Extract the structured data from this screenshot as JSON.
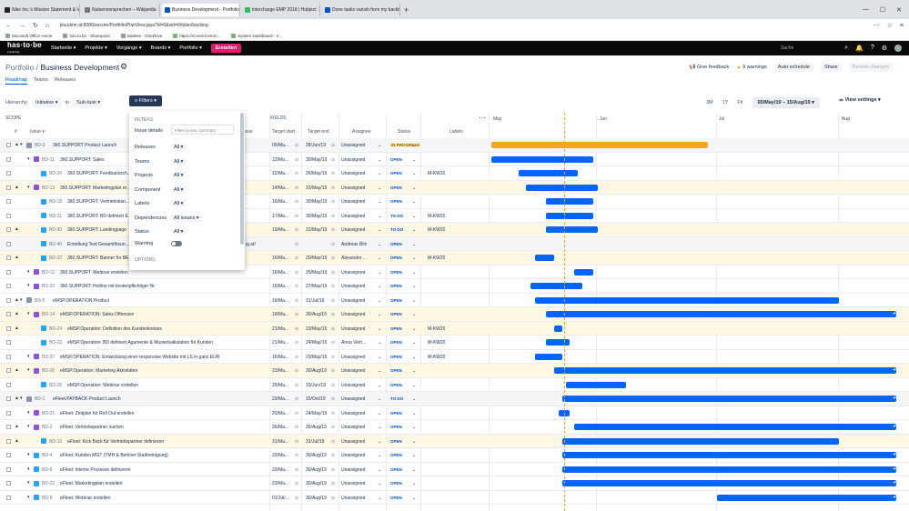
{
  "browser": {
    "tabs": [
      {
        "title": "Nike Inc.'s Mission Statement & Vision",
        "active": false,
        "fav": "#222"
      },
      {
        "title": "Nutzenversprechen – Wikipedia",
        "active": false,
        "fav": "#777"
      },
      {
        "title": "Business Development - Portfolio",
        "active": true,
        "fav": "#0052cc"
      },
      {
        "title": "intercharge EMP 2018 | Hubject",
        "active": false,
        "fav": "#3b6"
      },
      {
        "title": "Done tasks vanish from my backlog",
        "active": false,
        "fav": "#0052cc"
      }
    ],
    "new_tab": "+",
    "url": "jira.kkmr.at:8080/secure/PortfolioPlanView.jspa?id=6&sid=6#plan/backlog",
    "bookmarks": [
      "Microsoft Office Home",
      "has.to.be - Sharepoint",
      "Dateien - OneDrive",
      "https://ncontrol.eKon...",
      "System Dashboard - X..."
    ]
  },
  "jira_nav": {
    "logo": "has·to·be",
    "logo_sub": "emobility",
    "items": [
      "Startseite ▾",
      "Projekte ▾",
      "Vorgänge ▾",
      "Boards ▾",
      "Portfolio ▾"
    ],
    "create": "Erstellen",
    "search_placeholder": "Suche"
  },
  "header": {
    "breadcrumb_root": "Portfolio",
    "breadcrumb_sep": "/",
    "title": "Business Development",
    "tabs": [
      "Roadmap",
      "Teams",
      "Releases"
    ],
    "give_feedback": "Give feedback",
    "warnings": "9 warnings",
    "auto_schedule": "Auto-schedule",
    "share": "Share",
    "review_changes": "Review changes"
  },
  "controls": {
    "hierarchy_label": "Hierarchy:",
    "hierarchy_from": "Initiative",
    "hierarchy_to_label": "to",
    "hierarchy_to": "Sub-task",
    "filters": "Filters",
    "zoom": [
      "3M",
      "1Y",
      "Fit"
    ],
    "range": "05/May/19 – 15/Aug/19",
    "view_settings": "View settings"
  },
  "columns": {
    "scope": "SCOPE",
    "issue": "Issue",
    "fields": "FIELDS",
    "target_start": "Target start",
    "target_end": "Target end",
    "assignee": "Assignee",
    "status": "Status",
    "labels": "Labels",
    "months": [
      "May",
      "Jun",
      "Jul",
      "Aug"
    ],
    "issue_partial": "e issue"
  },
  "filter_panel": {
    "title": "FILTERS",
    "include_label": "lnoue details",
    "search_placeholder": "Filter by key, summary",
    "rows": [
      {
        "label": "Releases",
        "value": "All"
      },
      {
        "label": "Teams",
        "value": "All"
      },
      {
        "label": "Projects",
        "value": "All"
      },
      {
        "label": "Component",
        "value": "All"
      },
      {
        "label": "Labels",
        "value": "All"
      },
      {
        "label": "Dependencies",
        "value": "All issues"
      },
      {
        "label": "Status",
        "value": "All"
      }
    ],
    "warning_label": "Warning",
    "options": "OPTIONS"
  },
  "rows": [
    {
      "key": "BD-3",
      "summary": "360.SUPPORT Product Launch",
      "type": "init",
      "indent": 0,
      "start": "05/Ma...",
      "end": "28/Jun/19",
      "assignee": "Unassigned",
      "status": "IN PROGRESS",
      "labels": "",
      "bar": [
        540,
        778
      ],
      "color": "orange",
      "style": "grey",
      "warn": true
    },
    {
      "key": "BD-11",
      "summary": "360.SUPPORT: Sales",
      "type": "epic",
      "indent": 1,
      "start": "12/Ma...",
      "end": "30/May/19",
      "assignee": "Unassigned",
      "status": "OPEN",
      "labels": "",
      "bar": [
        540,
        652
      ],
      "style": ""
    },
    {
      "key": "BD-20",
      "summary": "360.SUPPORT: Feedbacksch...",
      "type": "story",
      "indent": 2,
      "start": "12/Ma...",
      "end": "26/May/19",
      "assignee": "Unassigned",
      "status": "OPEN",
      "labels": "M-KW20",
      "bar": [
        570,
        635
      ],
      "style": ""
    },
    {
      "key": "BD-13",
      "summary": "360.SUPPORT: Marketingplan er...",
      "type": "epic",
      "indent": 1,
      "start": "14/Ma...",
      "end": "31/May/19",
      "assignee": "Unassigned",
      "status": "OPEN",
      "labels": "",
      "bar": [
        578,
        657
      ],
      "style": "alt",
      "warn": true
    },
    {
      "key": "BD-18",
      "summary": "360.SUPPORT: Vertriebskan...",
      "type": "story",
      "indent": 2,
      "start": "16/Ma...",
      "end": "30/May/19",
      "assignee": "Unassigned",
      "status": "OPEN",
      "labels": "",
      "bar": [
        600,
        652
      ],
      "style": ""
    },
    {
      "key": "BD-31",
      "summary": "360.SUPPORT: BD definiert E...",
      "type": "story",
      "indent": 2,
      "start": "17/Ma...",
      "end": "30/May/19",
      "assignee": "Unassigned",
      "status": "TO DO",
      "labels": "M-KW20",
      "bar": [
        600,
        652
      ],
      "style": ""
    },
    {
      "key": "BD-30",
      "summary": "360.SUPPORT: Landingpage",
      "type": "story",
      "indent": 2,
      "start": "19/Ma...",
      "end": "31/May/19",
      "assignee": "Unassigned",
      "status": "TO DO",
      "labels": "M-KW20",
      "bar": [
        600,
        657
      ],
      "style": "alt",
      "warn": true
    },
    {
      "key": "BD-40",
      "summary": "Erstellung Text Gesamtlösun...",
      "type": "story",
      "indent": 2,
      "start": "",
      "end": "",
      "assignee": "Andreas Blin",
      "status": "OPEN",
      "labels": "",
      "bar": null,
      "style": "grey",
      "extra": "ig.at/"
    },
    {
      "key": "BD-32",
      "summary": "360.SUPPORT: Banner für BE...",
      "type": "story",
      "indent": 2,
      "start": "16/Ma...",
      "end": "20/May/19",
      "assignee": "Alexander ...",
      "status": "OPEN",
      "labels": "M-KW20",
      "bar": [
        588,
        609
      ],
      "style": "alt",
      "warn": true
    },
    {
      "key": "BD-12",
      "summary": "360.SUPPORT: Webinar erstellen",
      "type": "epic",
      "indent": 1,
      "start": "16/Ma...",
      "end": "25/May/19",
      "assignee": "Unassigned",
      "status": "OPEN",
      "labels": "",
      "bar": [
        631,
        652
      ],
      "style": ""
    },
    {
      "key": "BD-33",
      "summary": "360.SUPPORT: Hotline mit kostenpflichtiger Nr.",
      "type": "epic",
      "indent": 1,
      "start": "15/Ma...",
      "end": "27/May/19",
      "assignee": "Unassigned",
      "status": "OPEN",
      "labels": "",
      "bar": [
        583,
        640
      ],
      "style": ""
    },
    {
      "key": "BD-5",
      "summary": "eMSP.OPERATION Product",
      "type": "init",
      "indent": 0,
      "start": "16/Ma...",
      "end": "31/Jul/19",
      "assignee": "Unassigned",
      "status": "OPEN",
      "labels": "",
      "bar": [
        588,
        922
      ],
      "style": "",
      "warn": true
    },
    {
      "key": "BD-14",
      "summary": "eMSP.OPERATION: Sales Offensive",
      "type": "epic",
      "indent": 1,
      "start": "19/Ma...",
      "end": "30/Aug/19",
      "assignee": "Unassigned",
      "status": "OPEN",
      "labels": "",
      "bar": [
        600,
        985
      ],
      "style": "alt",
      "warn": true,
      "more": true
    },
    {
      "key": "BD-24",
      "summary": "eMSP.Operation: Definition des Kundenkreises",
      "type": "story",
      "indent": 2,
      "start": "21/Ma...",
      "end": "23/May/19",
      "assignee": "Unassigned",
      "status": "OPEN",
      "labels": "M-KW20",
      "bar": [
        609,
        618
      ],
      "style": "alt",
      "warn": true
    },
    {
      "key": "BD-23",
      "summary": "eMSP.Operation: BD definiert Agumente & Musterkalkulation für Kunden",
      "type": "story",
      "indent": 2,
      "start": "21/Ma...",
      "end": "24/May/19",
      "assignee": "Anna Vieh...",
      "status": "OPEN",
      "labels": "M-KW20",
      "bar": [
        600,
        626
      ],
      "style": ""
    },
    {
      "key": "BD-37",
      "summary": "eMSP.OPERATION: Entwicklung einer responsive Website mit LS in ganz EUR",
      "type": "epic",
      "indent": 1,
      "start": "16/Ma...",
      "end": "23/May/19",
      "assignee": "Unassigned",
      "status": "OPEN",
      "labels": "M-KW20",
      "bar": [
        588,
        618
      ],
      "style": ""
    },
    {
      "key": "BD-26",
      "summary": "eMSP.Operation: Marketing Aktivitäten",
      "type": "epic",
      "indent": 1,
      "start": "23/Ma...",
      "end": "30/Aug/19",
      "assignee": "Unassigned",
      "status": "OPEN",
      "labels": "",
      "bar": [
        609,
        985
      ],
      "style": "alt",
      "warn": true,
      "more": true
    },
    {
      "key": "BD-25",
      "summary": "eMSP.Operation: Webinar erstellen",
      "type": "story",
      "indent": 2,
      "start": "26/Ma...",
      "end": "15/Jun/19",
      "assignee": "Unassigned",
      "status": "OPEN",
      "labels": "",
      "bar": [
        622,
        688
      ],
      "style": ""
    },
    {
      "key": "BD-1",
      "summary": "eFleet.PAYBACK Product Launch",
      "type": "init",
      "indent": 0,
      "start": "23/Ma...",
      "end": "15/Oct/19",
      "assignee": "Unassigned",
      "status": "TO DO",
      "labels": "",
      "bar": [
        618,
        985
      ],
      "style": "grey",
      "warn": true,
      "more": true
    },
    {
      "key": "BD-21",
      "summary": "eFleet: Zeitplan für Roll Out erstellen",
      "type": "epic",
      "indent": 1,
      "start": "20/Ma...",
      "end": "24/May/19",
      "assignee": "Unassigned",
      "status": "OPEN",
      "labels": "",
      "bar": [
        614,
        626
      ],
      "style": ""
    },
    {
      "key": "BD-2",
      "summary": "eFleet: Vertriebspartner suchen",
      "type": "epic",
      "indent": 1,
      "start": "26/Ma...",
      "end": "30/Aug/19",
      "assignee": "Unassigned",
      "status": "OPEN",
      "labels": "",
      "bar": [
        631,
        985
      ],
      "style": "",
      "warn": true,
      "more": true
    },
    {
      "key": "BD-10",
      "summary": "eFleet: Kick Back für Vertriebspartner definieren",
      "type": "story",
      "indent": 2,
      "start": "31/Ma...",
      "end": "31/Jul/19",
      "assignee": "Unassigned",
      "status": "OPEN",
      "labels": "",
      "bar": [
        618,
        922
      ],
      "style": "alt",
      "warn": true
    },
    {
      "key": "BD-4",
      "summary": "eFleet: Kunden MGT (TMH & Berliner Stadtreinigung)",
      "type": "story",
      "indent": 1,
      "start": "23/Ma...",
      "end": "30/Aug/19",
      "assignee": "Unassigned",
      "status": "OPEN",
      "labels": "",
      "bar": [
        618,
        985
      ],
      "style": "",
      "more": true
    },
    {
      "key": "BD-8",
      "summary": "eFleet: interne Prozesse definieren",
      "type": "story",
      "indent": 1,
      "start": "23/Ma...",
      "end": "30/Aug/19",
      "assignee": "Unassigned",
      "status": "OPEN",
      "labels": "",
      "bar": [
        618,
        985
      ],
      "style": "",
      "more": true
    },
    {
      "key": "BD-22",
      "summary": "eFleet: Marketingplan erstellen",
      "type": "story",
      "indent": 1,
      "start": "23/Ma...",
      "end": "30/Aug/19",
      "assignee": "Unassigned",
      "status": "OPEN",
      "labels": "",
      "bar": [
        618,
        985
      ],
      "style": "",
      "more": true
    },
    {
      "key": "BD-9",
      "summary": "eFleet: Webinar erstellen",
      "type": "story",
      "indent": 1,
      "start": "01/Jul/...",
      "end": "30/Aug/19",
      "assignee": "Unassigned",
      "status": "OPEN",
      "labels": "",
      "bar": [
        788,
        985
      ],
      "style": "",
      "more": true
    }
  ]
}
